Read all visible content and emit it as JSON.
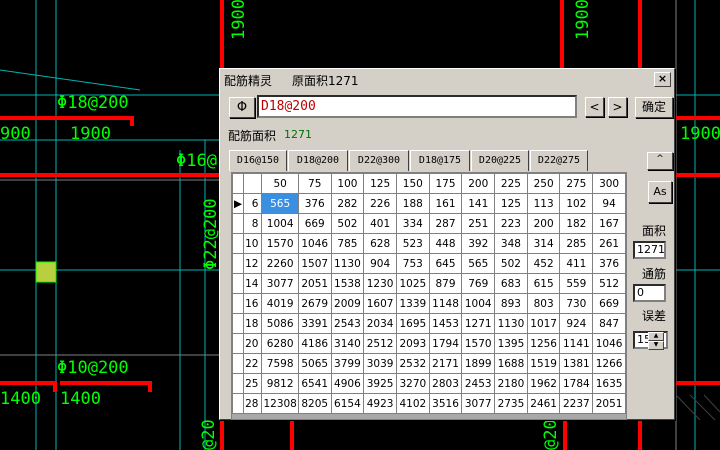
{
  "cad": {
    "labels": {
      "dim_top_a": "1900",
      "dim_top_b": "1900",
      "rebar_a": "Φ18@200",
      "dim_left_a": "900",
      "dim_left_b": "1900",
      "rebar_b": "Φ16@",
      "dim_vert": "Φ22@200",
      "dim_right": "1900",
      "rebar_c": "Φ10@200",
      "dim_bot_a": "1400",
      "dim_bot_b": "1400",
      "dim_bot_c": "@20",
      "dim_bot_d": "@20"
    }
  },
  "dialog": {
    "title": "配筋精灵",
    "original_area": "原面积1271",
    "close_label": "×",
    "symbol_button": "Φ",
    "spec_value": "D18@200",
    "prev_label": "<",
    "next_label": ">",
    "ok_label": "确定",
    "area_label": "配筋面积",
    "area_value": "1271",
    "tabs": [
      "D16@150",
      "D18@200",
      "D22@300",
      "D18@175",
      "D20@225",
      "D22@275"
    ],
    "up_label": "^",
    "as_label": "As",
    "side": {
      "area_label": "面积",
      "area_value": "1271",
      "through_label": "通筋",
      "through_value": "0",
      "error_label": "误差",
      "error_value": "15"
    },
    "grid": {
      "row_marker": "▶",
      "col_headers": [
        "50",
        "75",
        "100",
        "125",
        "150",
        "175",
        "200",
        "225",
        "250",
        "275",
        "300"
      ],
      "rows": [
        {
          "d": "6",
          "v": [
            "565",
            "376",
            "282",
            "226",
            "188",
            "161",
            "141",
            "125",
            "113",
            "102",
            "94"
          ]
        },
        {
          "d": "8",
          "v": [
            "1004",
            "669",
            "502",
            "401",
            "334",
            "287",
            "251",
            "223",
            "200",
            "182",
            "167"
          ]
        },
        {
          "d": "10",
          "v": [
            "1570",
            "1046",
            "785",
            "628",
            "523",
            "448",
            "392",
            "348",
            "314",
            "285",
            "261"
          ]
        },
        {
          "d": "12",
          "v": [
            "2260",
            "1507",
            "1130",
            "904",
            "753",
            "645",
            "565",
            "502",
            "452",
            "411",
            "376"
          ]
        },
        {
          "d": "14",
          "v": [
            "3077",
            "2051",
            "1538",
            "1230",
            "1025",
            "879",
            "769",
            "683",
            "615",
            "559",
            "512"
          ]
        },
        {
          "d": "16",
          "v": [
            "4019",
            "2679",
            "2009",
            "1607",
            "1339",
            "1148",
            "1004",
            "893",
            "803",
            "730",
            "669"
          ]
        },
        {
          "d": "18",
          "v": [
            "5086",
            "3391",
            "2543",
            "2034",
            "1695",
            "1453",
            "1271",
            "1130",
            "1017",
            "924",
            "847"
          ]
        },
        {
          "d": "20",
          "v": [
            "6280",
            "4186",
            "3140",
            "2512",
            "2093",
            "1794",
            "1570",
            "1395",
            "1256",
            "1141",
            "1046"
          ]
        },
        {
          "d": "22",
          "v": [
            "7598",
            "5065",
            "3799",
            "3039",
            "2532",
            "2171",
            "1899",
            "1688",
            "1519",
            "1381",
            "1266"
          ]
        },
        {
          "d": "25",
          "v": [
            "9812",
            "6541",
            "4906",
            "3925",
            "3270",
            "2803",
            "2453",
            "2180",
            "1962",
            "1784",
            "1635"
          ]
        },
        {
          "d": "28",
          "v": [
            "12308",
            "8205",
            "6154",
            "4923",
            "4102",
            "3516",
            "3077",
            "2735",
            "2461",
            "2237",
            "2051"
          ]
        }
      ]
    }
  },
  "colors": {
    "accent": "#3a8fe0",
    "spec_text": "#c00000",
    "area_text": "#007000",
    "cad_red": "#ff0000",
    "cad_green": "#00ff00",
    "cad_cyan": "#00c8c8"
  }
}
